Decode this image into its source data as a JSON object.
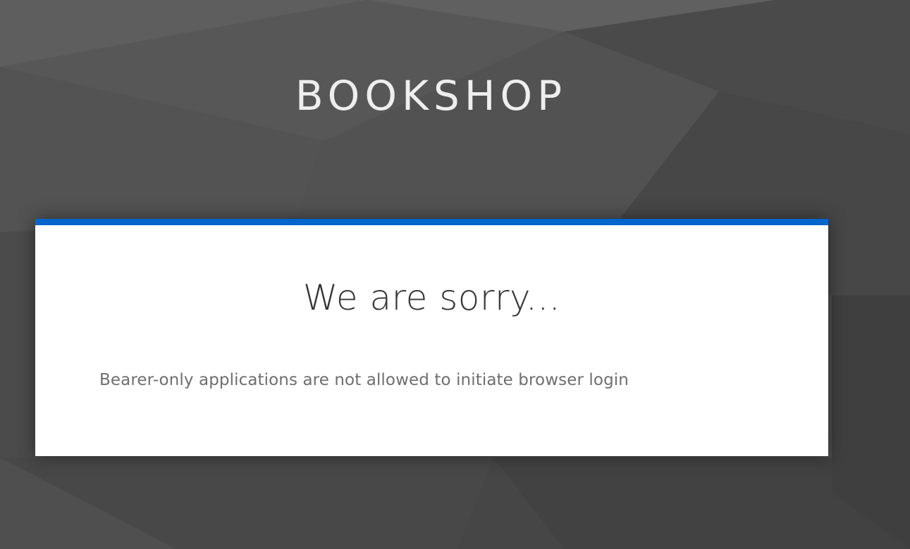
{
  "header": {
    "brand": "BOOKSHOP"
  },
  "error_card": {
    "title": "We are sorry...",
    "message": "Bearer-only applications are not allowed to initiate browser login",
    "accent_color": "#0066cc"
  },
  "theme": {
    "background_color": "#4d4d4d",
    "card_background": "#ffffff",
    "brand_text_color": "#eeeeee"
  }
}
